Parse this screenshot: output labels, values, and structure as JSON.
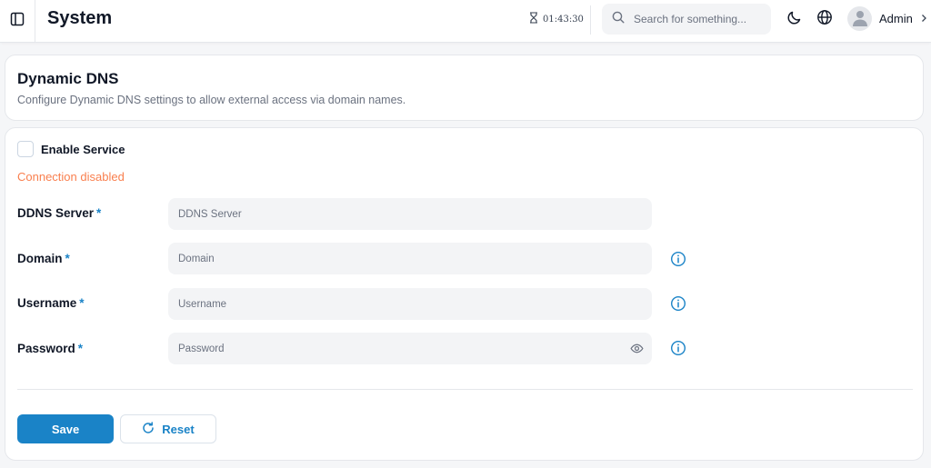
{
  "header": {
    "title": "System",
    "clock": "01:43:30",
    "search_placeholder": "Search for something...",
    "user_name": "Admin"
  },
  "section": {
    "title": "Dynamic DNS",
    "description": "Configure Dynamic DNS settings to allow external access via domain names."
  },
  "form": {
    "enable_label": "Enable Service",
    "enable_checked": false,
    "status_text": "Connection disabled",
    "required_mark": "*",
    "fields": [
      {
        "label": "DDNS Server",
        "placeholder": "DDNS Server",
        "value": "",
        "info": false
      },
      {
        "label": "Domain",
        "placeholder": "Domain",
        "value": "",
        "info": true
      },
      {
        "label": "Username",
        "placeholder": "Username",
        "value": "",
        "info": true
      },
      {
        "label": "Password",
        "placeholder": "Password",
        "value": "",
        "info": true
      }
    ],
    "save_label": "Save",
    "reset_label": "Reset"
  },
  "colors": {
    "primary": "#1a83c7",
    "warning_text": "#f97f4e",
    "input_bg": "#f3f4f6",
    "page_bg": "#f5f6f8"
  },
  "icons": {
    "sidebar_toggle": "sidebar-panel-icon",
    "clock": "hourglass-icon",
    "search": "search-icon",
    "theme": "moon-icon",
    "language": "globe-icon",
    "avatar": "user-icon",
    "user_menu": "chevron-right-icon",
    "info": "info-circle-icon",
    "password_toggle": "eye-icon",
    "reset": "refresh-icon"
  }
}
